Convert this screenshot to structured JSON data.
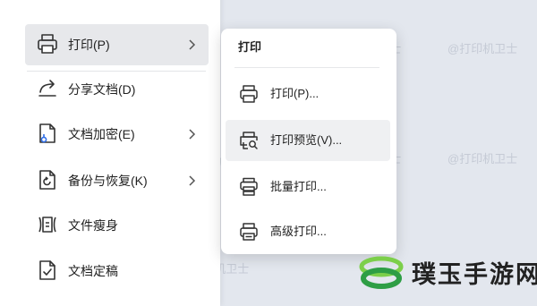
{
  "watermark_text": "@打印机卫士",
  "main_menu": {
    "items": [
      {
        "id": "print",
        "label": "打印(P)",
        "icon": "printer-icon",
        "has_submenu": true,
        "active": true
      },
      {
        "id": "share",
        "label": "分享文档(D)",
        "icon": "share-icon",
        "has_submenu": false
      },
      {
        "id": "encrypt",
        "label": "文档加密(E)",
        "icon": "document-lock-icon",
        "has_submenu": true
      },
      {
        "id": "backup",
        "label": "备份与恢复(K)",
        "icon": "backup-icon",
        "has_submenu": true
      },
      {
        "id": "slim",
        "label": "文件瘦身",
        "icon": "file-compress-icon",
        "has_submenu": false
      },
      {
        "id": "finalize",
        "label": "文档定稿",
        "icon": "document-check-icon",
        "has_submenu": false
      }
    ]
  },
  "submenu": {
    "title": "打印",
    "items": [
      {
        "id": "print",
        "label": "打印(P)...",
        "icon": "printer-icon"
      },
      {
        "id": "preview",
        "label": "打印预览(V)...",
        "icon": "print-preview-icon",
        "hover": true
      },
      {
        "id": "batch",
        "label": "批量打印...",
        "icon": "batch-print-icon"
      },
      {
        "id": "advanced",
        "label": "高级打印...",
        "icon": "advanced-print-icon"
      }
    ]
  },
  "brand": {
    "name": "璞玉手游网",
    "colors": {
      "primary": "#2e9e45",
      "secondary": "#7ccf4a"
    }
  },
  "colors": {
    "background": "#e3e7ee",
    "menu_bg": "#ffffff",
    "active_row": "#e7e8eb",
    "hover_row": "#eff0f2",
    "text": "#222222",
    "accent_blue": "#2f6ee8"
  }
}
